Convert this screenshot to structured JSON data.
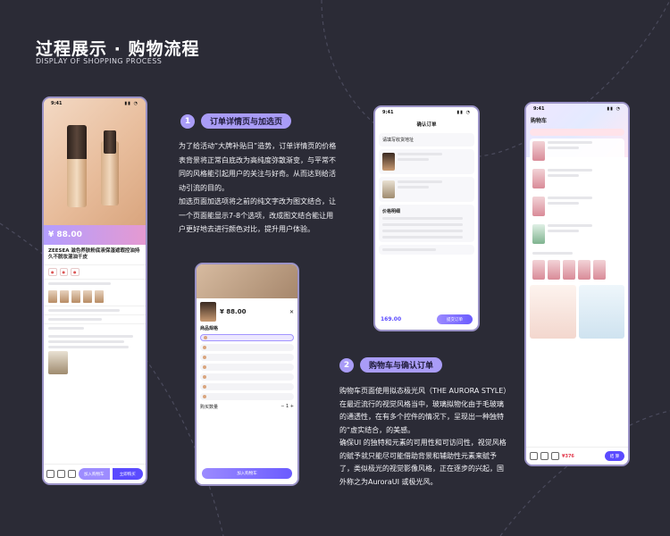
{
  "header": {
    "title": "过程展示 · 购物流程",
    "subtitle": "DISPLAY OF SHOPPING PROCESS"
  },
  "section1": {
    "number": "1",
    "label": "订单详情页与加选页",
    "paragraphs": [
      "为了给活动“大牌补贴日”造势，订单详情页的价格表背景将正常白底改为高纯度弥散渐变，与平常不同的风格能引起用户的关注与好奇。从而达到给活动引流的目的。",
      "加选页面加选项将之前的纯文字改为图文结合，让一个页面能显示7-8个选项，改成图文结合能让用户更好地去进行颜色对比，提升用户体验。"
    ]
  },
  "section2": {
    "number": "2",
    "label": "购物车与确认订单",
    "paragraphs": [
      "购物车页面使用拟态极光风（THE AURORA STYLE）",
      "在最近流行的视觉风格当中，玻璃拟物化由于毛玻璃的通透性，在有多个控件的情况下，呈现出一种独特的“虚实结合，的美感。",
      "确保UI 的独特和元素的可用性和可访问性，视觉风格的赋予就只能尽可能借助背景和辅助性元素来赋予了，类似极光的视觉影像风格，正在逐步的兴起，国外称之为AuroraUI 或极光风。"
    ]
  },
  "phone1": {
    "time": "9:41",
    "price": "¥ 88.00",
    "brand": "ZEESEA",
    "name": "ZEESEA 滋色养肤粉底液保湿遮瑕控油持久不脱妆混油干皮",
    "add_cart": "加入购物车",
    "buy_now": "立即购买"
  },
  "phone2": {
    "price": "¥ 88.00",
    "section": "商品规格",
    "qty_label": "购买数量",
    "add_cart": "加入购物车"
  },
  "phone3": {
    "time": "9:41",
    "title": "确认订单",
    "address": "请填写收货地址",
    "price_detail": "价格明细",
    "total": "169.00",
    "submit": "提交订单"
  },
  "phone4": {
    "time": "9:41",
    "title": "购物车",
    "total": "¥376",
    "settle": "结 算"
  }
}
